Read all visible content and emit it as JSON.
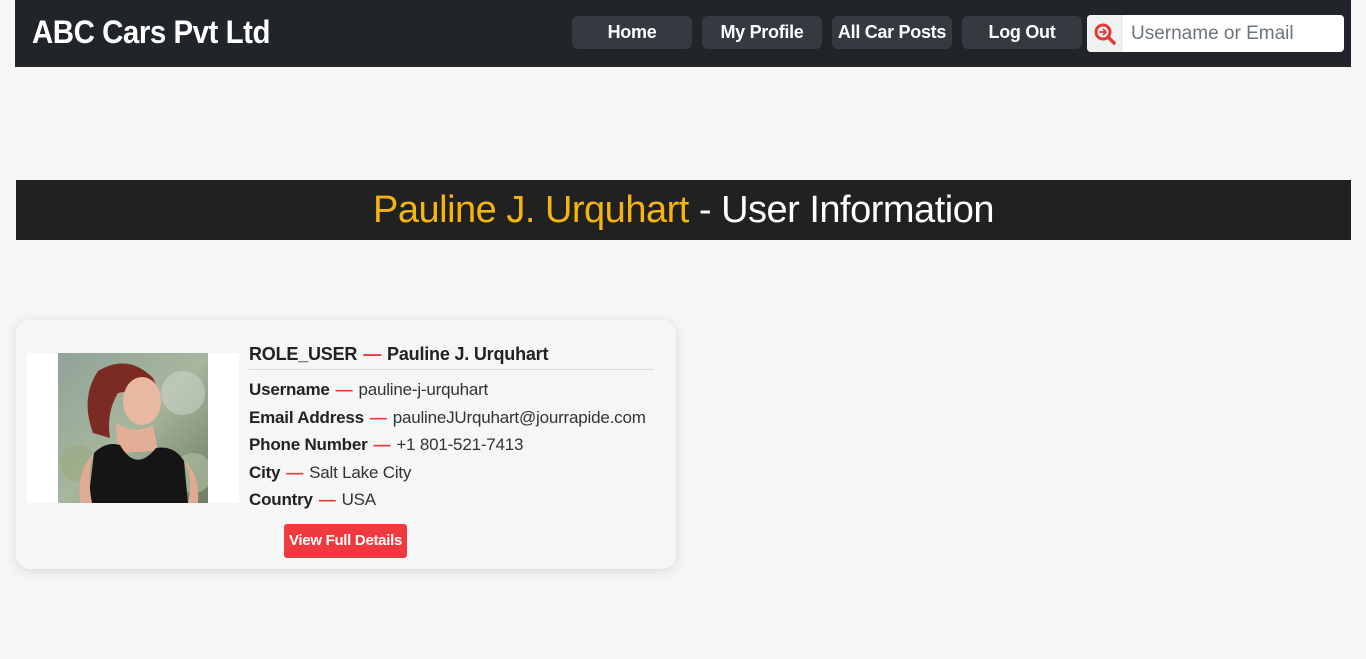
{
  "brand": "ABC Cars Pvt Ltd",
  "nav": {
    "home": "Home",
    "my_profile": "My Profile",
    "all_car_posts": "All Car Posts",
    "log_out": "Log Out"
  },
  "search": {
    "placeholder": "Username or Email",
    "icon": "search-icon"
  },
  "title": {
    "name": "Pauline J. Urquhart",
    "suffix": " - User Information"
  },
  "user": {
    "role": "ROLE_USER",
    "name": "Pauline J. Urquhart",
    "fields": {
      "username_label": "Username",
      "username": "pauline-j-urquhart",
      "email_label": "Email Address",
      "email": "paulineJUrquhart@jourrapide.com",
      "phone_label": "Phone Number",
      "phone": "+1 801-521-7413",
      "city_label": "City",
      "city": "Salt Lake City",
      "country_label": "Country",
      "country": "USA"
    },
    "dash": "—"
  },
  "actions": {
    "view_full_details": "View Full Details"
  },
  "colors": {
    "navbar": "#212529",
    "accent_yellow": "#f5b40f",
    "accent_red": "#f0393e"
  }
}
